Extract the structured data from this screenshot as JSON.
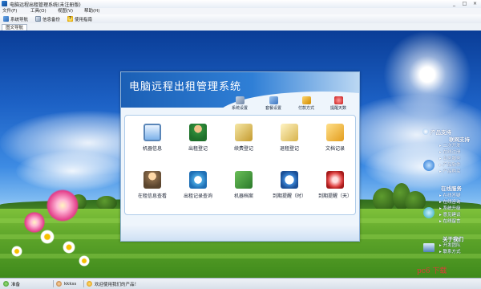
{
  "window": {
    "title": "电脑远程出租管理系统(未注册版)",
    "controls": {
      "minimize": "_",
      "maximize": "□",
      "close": "×"
    }
  },
  "menu": [
    "文件(F)",
    "工具(O)",
    "视图(V)",
    "帮助(H)"
  ],
  "toolbar": [
    {
      "label": "系统导航",
      "icon": "navigation-icon"
    },
    {
      "label": "信息备份",
      "icon": "backup-icon"
    },
    {
      "label": "使用指南",
      "icon": "help-icon"
    }
  ],
  "tabs": [
    "图文导航"
  ],
  "panel": {
    "title": "电脑远程出租管理系统",
    "top_actions": [
      {
        "label": "系统设置",
        "icon": "system-settings-icon"
      },
      {
        "label": "套餐设置",
        "icon": "package-settings-icon"
      },
      {
        "label": "付款方式",
        "icon": "payment-icon"
      },
      {
        "label": "提醒天数",
        "icon": "reminder-icon"
      }
    ],
    "functions": [
      {
        "label": "机器信息",
        "icon": "monitor-icon"
      },
      {
        "label": "出租登记",
        "icon": "person-icon"
      },
      {
        "label": "续费登记",
        "icon": "renew-icon"
      },
      {
        "label": "退租登记",
        "icon": "return-icon"
      },
      {
        "label": "文档记录",
        "icon": "folder-icon"
      },
      {
        "label": "在租信息查看",
        "icon": "user-view-icon"
      },
      {
        "label": "出租记录查询",
        "icon": "search-icon"
      },
      {
        "label": "机器档案",
        "icon": "archive-icon"
      },
      {
        "label": "到期提醒（时）",
        "icon": "clock-icon"
      },
      {
        "label": "到期提醒（天）",
        "icon": "bell-icon"
      }
    ]
  },
  "sidebar": {
    "product_support": {
      "title": "产品支持",
      "subtitle": "联网支持",
      "items": [
        "二次开发",
        "在线注册",
        "业务服务",
        "产品软件",
        "产品购买"
      ]
    },
    "online_service": {
      "title": "在线服务",
      "items": [
        "在线答疑",
        "在线咨询",
        "系统升级",
        "意见建议",
        "在线留言"
      ]
    },
    "about": {
      "title": "关于我们",
      "items": [
        "开发团队",
        "联系方式"
      ]
    }
  },
  "statusbar": {
    "ready": "准备",
    "user": "kkkss",
    "welcome": "欢迎使用我们的产品！"
  },
  "watermark": "pc6 下载"
}
